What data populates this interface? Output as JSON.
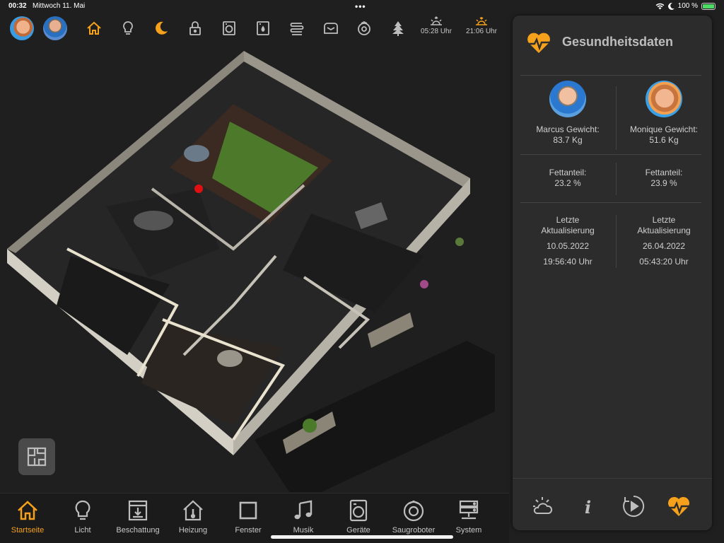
{
  "status": {
    "time": "00:32",
    "date": "Mittwoch 11. Mai",
    "dots": "•••",
    "battery": "100 %"
  },
  "top": {
    "icons": [
      "home-icon",
      "bulb-icon",
      "moon-icon",
      "lock-icon",
      "washer-icon",
      "dryer-icon",
      "heater-icon",
      "mailbox-icon",
      "robot-vacuum-icon",
      "tree-icon"
    ],
    "sunrise": "05:28 Uhr",
    "sunset": "21:06 Uhr"
  },
  "panel": {
    "title": "Gesundheitsdaten",
    "persons": [
      {
        "weight_label": "Marcus Gewicht:",
        "weight": "83.7 Kg",
        "fat_label": "Fettanteil:",
        "fat": "23.2 %",
        "update_label": "Letzte Aktualisierung",
        "update_date": "10.05.2022",
        "update_time": "19:56:40 Uhr"
      },
      {
        "weight_label": "Monique Gewicht:",
        "weight": "51.6 Kg",
        "fat_label": "Fettanteil:",
        "fat": "23.9 %",
        "update_label": "Letzte Aktualisierung",
        "update_date": "26.04.2022",
        "update_time": "05:43:20 Uhr"
      }
    ],
    "tabs": [
      "weather-icon",
      "info-icon",
      "play-icon",
      "heart-pulse-icon"
    ]
  },
  "nav": [
    {
      "label": "Startseite",
      "active": true
    },
    {
      "label": "Licht"
    },
    {
      "label": "Beschattung"
    },
    {
      "label": "Heizung"
    },
    {
      "label": "Fenster"
    },
    {
      "label": "Musik"
    },
    {
      "label": "Geräte"
    },
    {
      "label": "Saugroboter"
    },
    {
      "label": "System"
    }
  ],
  "colors": {
    "accent": "#f5a11c",
    "background": "#1f1f1f",
    "panel": "#2c2c2c",
    "text": "#cfcfcf"
  }
}
